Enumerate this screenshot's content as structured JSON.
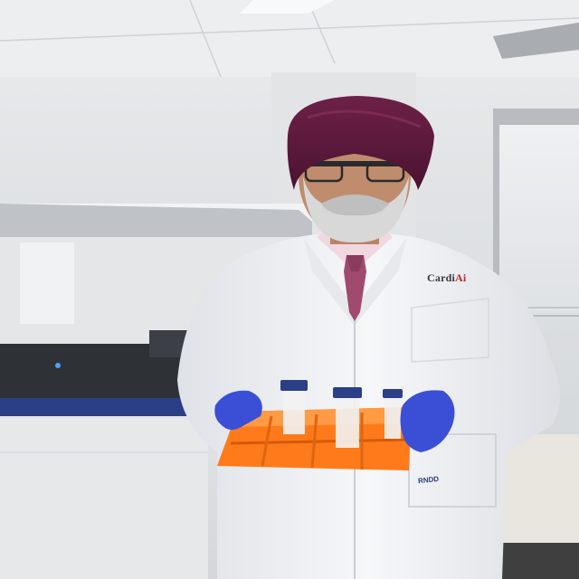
{
  "scene": {
    "coat_logo": {
      "prefix": "Cardi",
      "accent": "Ai",
      "accent_color": "#c0282d"
    },
    "pocket_tag": "RNDD",
    "colors": {
      "turban": "#5e1a3c",
      "coat": "#f1f3f6",
      "gloves": "#3a4fd6",
      "tube_rack": "#ff7a1a",
      "tube_caps": "#2a3f86",
      "tie": "#a04a6e",
      "instrument_trim": "#2b3f86"
    },
    "icons": [
      "lab-instrument",
      "test-tube-rack",
      "sample-tube",
      "window-blind"
    ]
  }
}
